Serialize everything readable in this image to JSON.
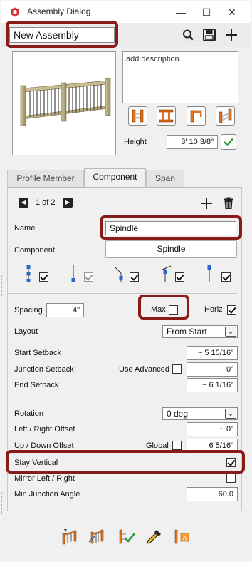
{
  "window": {
    "title": "Assembly Dialog",
    "minimize_glyph": "—",
    "maximize_glyph": "☐",
    "close_glyph": "✕"
  },
  "header": {
    "assembly_name": "New Assembly",
    "icons": [
      "search-icon",
      "save-icon",
      "add-icon"
    ]
  },
  "description": {
    "placeholder": "add description..."
  },
  "height": {
    "label": "Height",
    "value": "3' 10 3/8\""
  },
  "tabs": [
    {
      "label": "Profile Member",
      "active": false
    },
    {
      "label": "Component",
      "active": true
    },
    {
      "label": "Span",
      "active": false
    }
  ],
  "component_nav": {
    "page": "1 of 2",
    "prev_glyph": "◀",
    "next_glyph": "▶"
  },
  "component": {
    "name_label": "Name",
    "name_value": "Spindle",
    "component_label": "Component",
    "component_value": "Spindle",
    "vertical_options_checked": [
      true,
      true,
      true,
      true,
      true
    ]
  },
  "spacing": {
    "label": "Spacing",
    "value": "4\"",
    "max_label": "Max",
    "max_checked": false,
    "horiz_label": "Horiz",
    "horiz_checked": true
  },
  "layout": {
    "label": "Layout",
    "value": "From Start",
    "arrow": "⌄"
  },
  "setbacks": {
    "start_label": "Start Setback",
    "start_value": "~ 5 15/16\"",
    "junction_label": "Junction Setback",
    "use_advanced_label": "Use Advanced",
    "use_advanced_checked": false,
    "junction_value": "0\"",
    "end_label": "End Setback",
    "end_value": "~ 6 1/16\""
  },
  "transform": {
    "rotation_label": "Rotation",
    "rotation_value": "0 deg",
    "arrow": "⌄",
    "lr_offset_label": "Left / Right Offset",
    "lr_offset_value": "~ 0\"",
    "ud_offset_label": "Up / Down Offset",
    "global_label": "Global",
    "global_checked": false,
    "ud_offset_value": "6 5/16\"",
    "stay_vertical_label": "Stay Vertical",
    "stay_vertical_checked": true,
    "mirror_label": "Mirror Left / Right",
    "mirror_checked": false,
    "min_junction_label": "Min Junction Angle",
    "min_junction_value": "60.0"
  },
  "bottom_toolbar": [
    "draw-railing-icon",
    "edit-path-icon",
    "accept-icon",
    "eyedropper-icon",
    "label-icon"
  ],
  "colors": {
    "highlight": "#8b1a1a",
    "icon_orange": "#e0701b",
    "icon_blue": "#2a66c8",
    "accept_green": "#2d9d3c"
  }
}
